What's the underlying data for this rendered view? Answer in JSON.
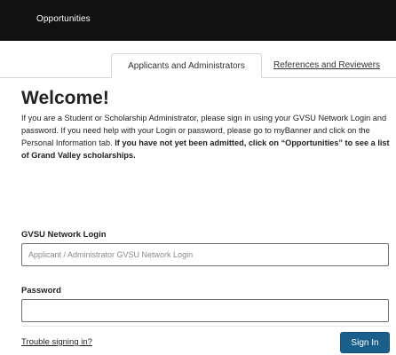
{
  "header": {
    "nav_link": "Opportunities",
    "background_color": "#111111"
  },
  "tabs": [
    {
      "label": "Applicants and Administrators",
      "active": true
    },
    {
      "label": "References and Reviewers",
      "active": false
    }
  ],
  "main": {
    "title": "Welcome!",
    "intro_text": "If you are a Student or Scholarship Administrator, please sign in using your GVSU Network Login and password. If you need help with your Login or password, please go to myBanner and click on the Personal Information tab.",
    "intro_bold": "If you have not yet been admitted, click on “Opportunities” to see a list of Grand Valley scholarships."
  },
  "form": {
    "login_label": "GVSU Network Login",
    "login_placeholder": "Applicant / Administrator GVSU Network Login",
    "login_value": "",
    "password_label": "Password",
    "password_value": ""
  },
  "footer": {
    "trouble_link": "Trouble signing in?",
    "signin_label": "Sign In",
    "signin_color": "#1a5f8c"
  }
}
